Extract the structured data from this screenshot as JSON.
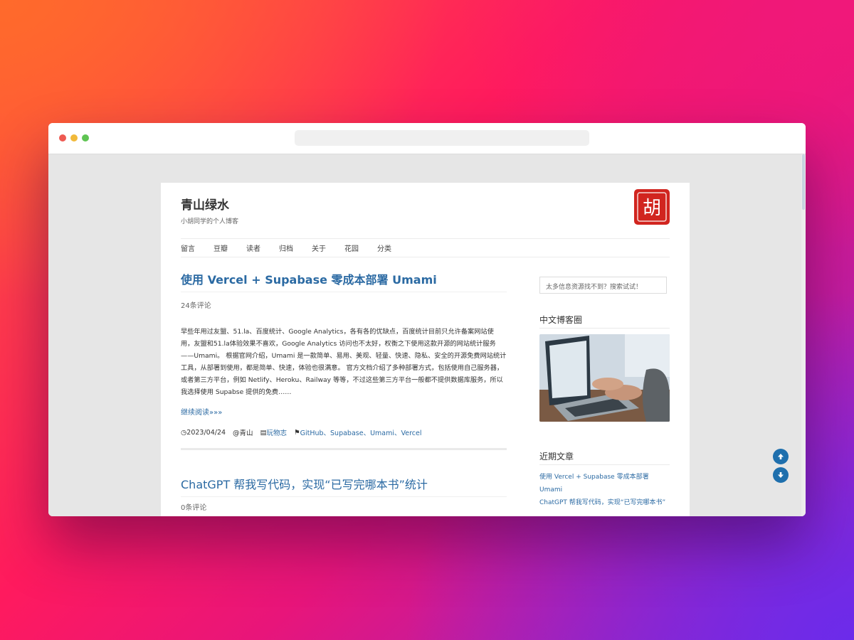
{
  "site": {
    "title": "青山绿水",
    "description": "小胡同学的个人博客",
    "logo_glyph": "胡"
  },
  "nav": {
    "items": [
      "留言",
      "豆瓣",
      "读者",
      "归档",
      "关于",
      "花园",
      "分类"
    ]
  },
  "post1": {
    "title": "使用 Vercel + Supabase 零成本部署 Umami",
    "comments": "24条评论",
    "excerpt": "早些年用过友盟、51.la、百度统计、Google Analytics，各有各的优缺点，百度统计目前只允许备案网站使用，友盟和51.la体验效果不喜欢，Google Analytics 访问也不太好，权衡之下使用这款开源的网站统计服务——Umami。 根据官网介绍，Umami 是一款简单、易用、美观、轻量、快速、隐私、安全的开源免费网站统计工具，从部署到使用，都是简单、快速，体验也很满意。 官方文档介绍了多种部署方式，包括使用自己服务器，或者第三方平台，例如 Netlify、Heroku、Railway 等等，不过这些第三方平台一般都不提供数据库服务，所以我选择使用 Supabse 提供的免费……",
    "read_more": "继续阅读»»»",
    "date": "◷2023/04/24",
    "author": "@青山",
    "category_icon": "▤",
    "category": "玩物志",
    "tags_icon": "⚑",
    "tags": "GitHub、Supabase、Umami、Vercel"
  },
  "post2": {
    "title": "ChatGPT 帮我写代码，实现“已写完哪本书”统计",
    "comments": "0条评论"
  },
  "sidebar": {
    "search_placeholder": "太多信息资源找不到？搜索试试！",
    "widget1_title": "中文博客圈",
    "widget2_title": "近期文章",
    "recent": [
      "使用 Vercel + Supabase 零成本部署 Umami",
      "ChatGPT 帮我写代码，实现“已写完哪本书”"
    ]
  },
  "colors": {
    "accent": "#2b6aa3",
    "logo_red": "#d1251f",
    "fab_blue": "#1e6fad"
  }
}
